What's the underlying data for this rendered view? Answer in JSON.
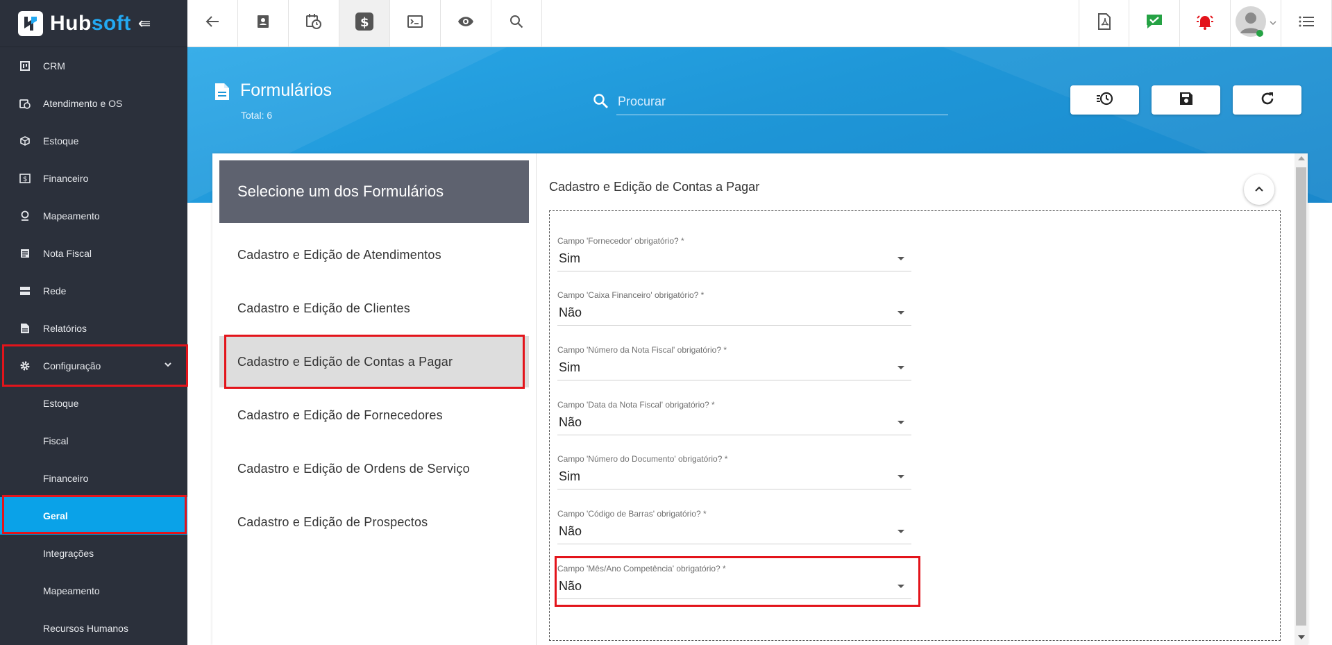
{
  "app": {
    "brand_part1": "Hub",
    "brand_part2": "soft"
  },
  "sidebar": {
    "items": [
      {
        "label": "CRM",
        "icon": "crm-board-icon"
      },
      {
        "label": "Atendimento e OS",
        "icon": "calendar-clock-icon"
      },
      {
        "label": "Estoque",
        "icon": "box-icon"
      },
      {
        "label": "Financeiro",
        "icon": "dollar-icon"
      },
      {
        "label": "Mapeamento",
        "icon": "map-pin-icon"
      },
      {
        "label": "Nota Fiscal",
        "icon": "document-icon"
      },
      {
        "label": "Rede",
        "icon": "server-icon"
      },
      {
        "label": "Relatórios",
        "icon": "report-icon"
      },
      {
        "label": "Configuração",
        "icon": "gear-icon",
        "expanded": true
      }
    ],
    "subitems": [
      {
        "label": "Estoque"
      },
      {
        "label": "Fiscal"
      },
      {
        "label": "Financeiro"
      },
      {
        "label": "Geral",
        "active": true
      },
      {
        "label": "Integrações"
      },
      {
        "label": "Mapeamento"
      },
      {
        "label": "Recursos Humanos"
      }
    ]
  },
  "topbar": {
    "left_icons": [
      "back-arrow-icon",
      "contact-card-icon",
      "calendar-clock-icon",
      "dollar-icon",
      "terminal-icon",
      "eye-icon",
      "search-icon"
    ],
    "right_icons": [
      "pdf-icon",
      "chat-check-icon",
      "alarm-bell-icon",
      "avatar",
      "list-menu-icon"
    ]
  },
  "header": {
    "title": "Formulários",
    "total": "Total: 6",
    "search_placeholder": "Procurar"
  },
  "forms_panel": {
    "header": "Selecione um dos Formulários",
    "items": [
      "Cadastro e Edição de Atendimentos",
      "Cadastro e Edição de Clientes",
      "Cadastro e Edição de Contas a Pagar",
      "Cadastro e Edição de Fornecedores",
      "Cadastro e Edição de Ordens de Serviço",
      "Cadastro e Edição de Prospectos"
    ],
    "active_index": 2
  },
  "detail": {
    "title": "Cadastro e Edição de Contas a Pagar",
    "fields": [
      {
        "label": "Campo 'Fornecedor' obrigatório? *",
        "value": "Sim"
      },
      {
        "label": "Campo 'Caixa Financeiro' obrigatório? *",
        "value": "Não"
      },
      {
        "label": "Campo 'Número da Nota Fiscal' obrigatório? *",
        "value": "Sim"
      },
      {
        "label": "Campo 'Data da Nota Fiscal' obrigatório? *",
        "value": "Não"
      },
      {
        "label": "Campo 'Número do Documento' obrigatório? *",
        "value": "Sim"
      },
      {
        "label": "Campo 'Código de Barras' obrigatório? *",
        "value": "Não"
      },
      {
        "label": "Campo 'Mês/Ano Competência' obrigatório? *",
        "value": "Não"
      }
    ]
  },
  "colors": {
    "sidebar_bg": "#2b303b",
    "accent": "#0aa2e8",
    "highlight_border": "#e3141b",
    "header_blue": "#1f97d8"
  }
}
